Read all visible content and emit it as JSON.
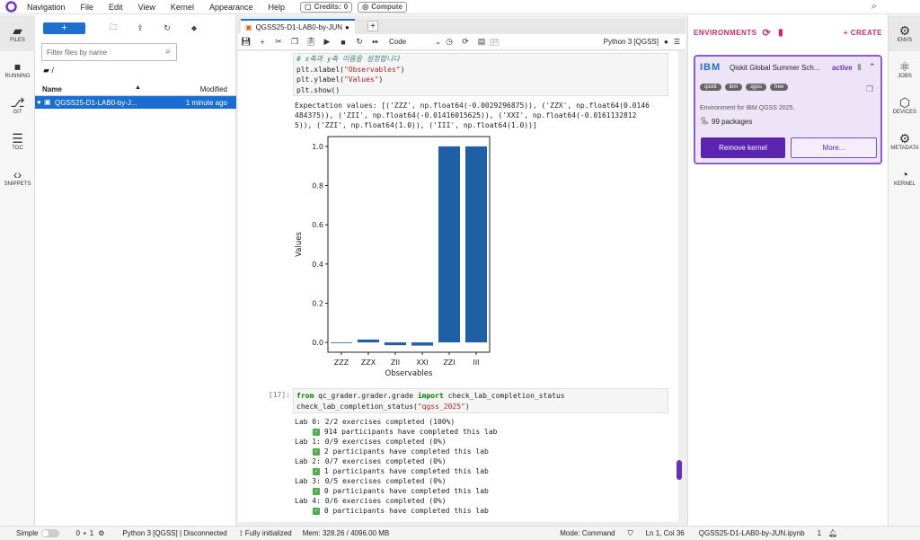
{
  "menubar": {
    "items": [
      "Navigation",
      "File",
      "Edit",
      "View",
      "Kernel",
      "Appearance",
      "Help"
    ],
    "credits_label": "Credits:",
    "credits_value": "0",
    "compute_label": "Compute"
  },
  "leftbar": {
    "items": [
      {
        "label": "FILES",
        "icon": "folder-icon"
      },
      {
        "label": "RUNNING",
        "icon": "stop-circle-icon"
      },
      {
        "label": "GIT",
        "icon": "git-icon"
      },
      {
        "label": "TOC",
        "icon": "list-icon"
      },
      {
        "label": "SNIPPETS",
        "icon": "code-brackets-icon"
      }
    ]
  },
  "filebrowser": {
    "new_label": "+",
    "filter_placeholder": "Filter files by name",
    "breadcrumb": "/",
    "columns": {
      "name": "Name",
      "modified": "Modified"
    },
    "files": [
      {
        "name": "QGSS25-D1-LAB0-by-J...",
        "modified": "1 minute ago"
      }
    ]
  },
  "notebook": {
    "tab_title": "QGSS25-D1-LAB0-by-JUN",
    "cell_type": "Code",
    "kernel": "Python 3 [QGSS]",
    "git_label": "git",
    "code_cell_1": {
      "comment": "# x축과 y축 이름을 설정합니다",
      "line2_fn": "plt.xlabel(",
      "line2_str": "\"Observables\"",
      "line3_fn": "plt.ylabel(",
      "line3_str": "\"Values\"",
      "line4": "plt.show()"
    },
    "output_1": "Expectation values: [('ZZZ', np.float64(-0.0029296875)), ('ZZX', np.float64(0.0146\n484375)), ('ZII', np.float64(-0.01416015625)), ('XXI', np.float64(-0.0161132812\n5)), ('ZZI', np.float64(1.0)), ('III', np.float64(1.0))]",
    "code_cell_2": {
      "prompt": "[17]:",
      "kw_from": "from",
      "module": " qc_grader.grader.grade ",
      "kw_import": "import",
      "imported": " check_lab_completion_status",
      "call_fn": "check_lab_completion_status(",
      "call_arg": "\"qgss_2025\""
    },
    "output_2": [
      {
        "text": "Lab 0: 2/2 exercises completed (100%)",
        "check": false
      },
      {
        "text": "914 participants have completed this lab",
        "check": true
      },
      {
        "text": "Lab 1: 0/9 exercises completed (0%)",
        "check": false
      },
      {
        "text": "2 participants have completed this lab",
        "check": true
      },
      {
        "text": "Lab 2: 0/7 exercises completed (0%)",
        "check": false
      },
      {
        "text": "1 participants have completed this lab",
        "check": true
      },
      {
        "text": "Lab 3: 0/5 exercises completed (0%)",
        "check": false
      },
      {
        "text": "0 participants have completed this lab",
        "check": true
      },
      {
        "text": "Lab 4: 0/6 exercises completed (0%)",
        "check": false
      },
      {
        "text": "0 participants have completed this lab",
        "check": true
      }
    ]
  },
  "chart_data": {
    "type": "bar",
    "categories": [
      "ZZZ",
      "ZZX",
      "ZII",
      "XXI",
      "ZZI",
      "III"
    ],
    "values": [
      -0.0029296875,
      0.0146484375,
      -0.01416015625,
      -0.01611328125,
      1.0,
      1.0
    ],
    "xlabel": "Observables",
    "ylabel": "Values",
    "yticks": [
      "0.0",
      "0.2",
      "0.4",
      "0.6",
      "0.8",
      "1.0"
    ],
    "ylim": [
      -0.05,
      1.05
    ],
    "bar_color": "#1f5fa6"
  },
  "envpanel": {
    "title": "ENVIRONMENTS",
    "create_label": "+ CREATE",
    "card": {
      "logo": "IBM",
      "name": "Qiskit Global Summer Sch...",
      "status": "active",
      "tags": [
        "qiskit",
        "ibm",
        "qgss",
        "free"
      ],
      "description": "Environment for IBM QGSS 2025.",
      "packages": "99 packages",
      "remove_label": "Remove kernel",
      "more_label": "More..."
    }
  },
  "rightbar": {
    "items": [
      {
        "label": "ENVS",
        "icon": "gear-icon"
      },
      {
        "label": "JOBS",
        "icon": "jobs-icon"
      },
      {
        "label": "DEVICES",
        "icon": "cube-icon"
      },
      {
        "label": "METADATA",
        "icon": "cogs-icon"
      },
      {
        "label": "KERNEL",
        "icon": "gauge-icon"
      }
    ]
  },
  "statusbar": {
    "mode_label": "Simple",
    "count1": "0",
    "count2": "1",
    "kernel_status": "Python 3 [QGSS] | Disconnected",
    "init_status": "Fully initialized",
    "memory": "Mem: 328.26 / 4096.00 MB",
    "command_mode": "Mode: Command",
    "position": "Ln 1, Col 36",
    "filename": "QGSS25-D1-LAB0-by-JUN.ipynb",
    "tab_count": "1"
  },
  "colors": {
    "accent": "#1a6ed1",
    "brand": "#d6246e",
    "purple": "#6a2fc2"
  }
}
